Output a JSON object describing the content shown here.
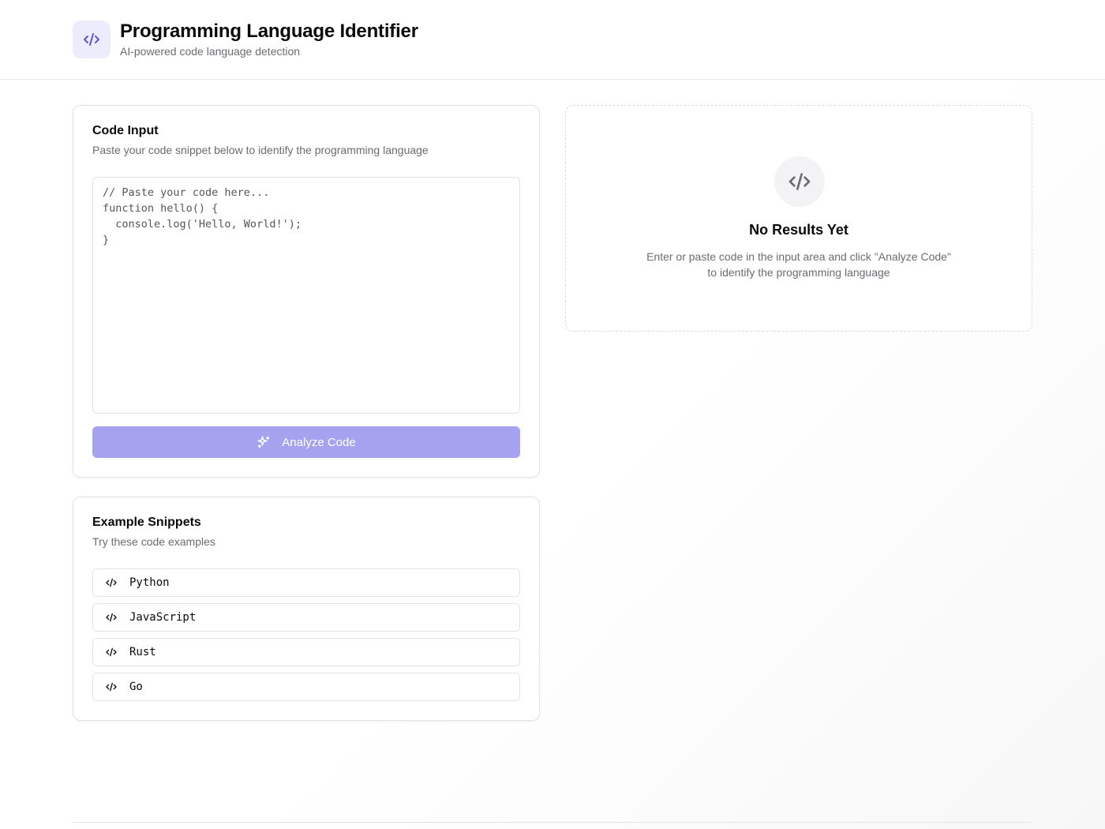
{
  "header": {
    "logo_icon": "code-icon",
    "title": "Programming Language Identifier",
    "subtitle": "AI-powered code language detection"
  },
  "code_input": {
    "title": "Code Input",
    "description": "Paste your code snippet below to identify the programming language",
    "placeholder": "// Paste your code here...\nfunction hello() {\n  console.log('Hello, World!');\n}",
    "value": "",
    "analyze_button": {
      "label": "Analyze Code",
      "icon": "sparkles-icon",
      "state": "disabled"
    }
  },
  "examples": {
    "title": "Example Snippets",
    "description": "Try these code examples",
    "items": [
      {
        "label": "Python",
        "icon": "code-icon"
      },
      {
        "label": "JavaScript",
        "icon": "code-icon"
      },
      {
        "label": "Rust",
        "icon": "code-icon"
      },
      {
        "label": "Go",
        "icon": "code-icon"
      }
    ]
  },
  "results": {
    "icon": "code-icon",
    "title": "No Results Yet",
    "description": "Enter or paste code in the input area and click \"Analyze Code\" to identify the programming language"
  },
  "colors": {
    "accent": "#6366f1",
    "accent_soft": "#ececfd",
    "button_disabled": "#a5a3f0"
  }
}
